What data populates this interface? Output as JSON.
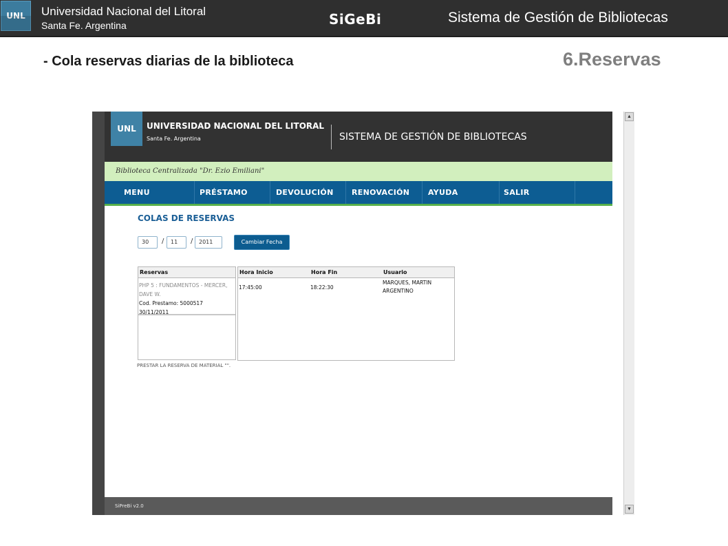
{
  "slide": {
    "logo_text": "UNL",
    "university": "Universidad Nacional del Litoral",
    "city": "Santa Fe. Argentina",
    "app_name": "SiGeBi",
    "system_name": "Sistema de Gestión de Bibliotecas",
    "subtitle": "- Cola reservas  diarias de la biblioteca",
    "section": "6.Reservas"
  },
  "app": {
    "logo_text": "UNL",
    "university": "UNIVERSIDAD NACIONAL DEL LITORAL",
    "city": "Santa Fe. Argentina",
    "system_name": "SISTEMA DE GESTIÓN DE BIBLIOTECAS",
    "library_name": "Biblioteca Centralizada \"Dr. Ezio Emiliani\"",
    "nav": [
      "MENU",
      "PRÉSTAMO",
      "DEVOLUCIÓN",
      "RENOVACIÓN",
      "AYUDA",
      "SALIR"
    ],
    "page_title": "COLAS DE RESERVAS",
    "date": {
      "day": "30",
      "month": "11",
      "year": "2011",
      "separator": "/"
    },
    "change_date_button": "Cambiar Fecha",
    "reservas": {
      "header": "Reservas",
      "items": [
        {
          "book": "PHP 5 : FUNDAMENTOS - MERCER, DAVE W.",
          "code": "Cod. Prestamo: 5000517",
          "date": "30/11/2011"
        }
      ]
    },
    "detail": {
      "headers": [
        "Hora Inicio",
        "Hora Fin",
        "Usuario"
      ],
      "rows": [
        {
          "start": "17:45:00",
          "end": "18:22:30",
          "user": "MARQUES, MARTIN ARGENTINO"
        }
      ]
    },
    "lend_link": "PRESTAR LA RESERVA DE MATERIAL \"\".",
    "footer_version": "SiPreBi v2.0"
  },
  "colors": {
    "slide_header_bg": "#2f2f2f",
    "app_nav_bg": "#0d5d93",
    "library_bar_bg": "#d2efbe",
    "title_blue": "#1b5f96",
    "nav_underline_green": "#57b04b"
  }
}
